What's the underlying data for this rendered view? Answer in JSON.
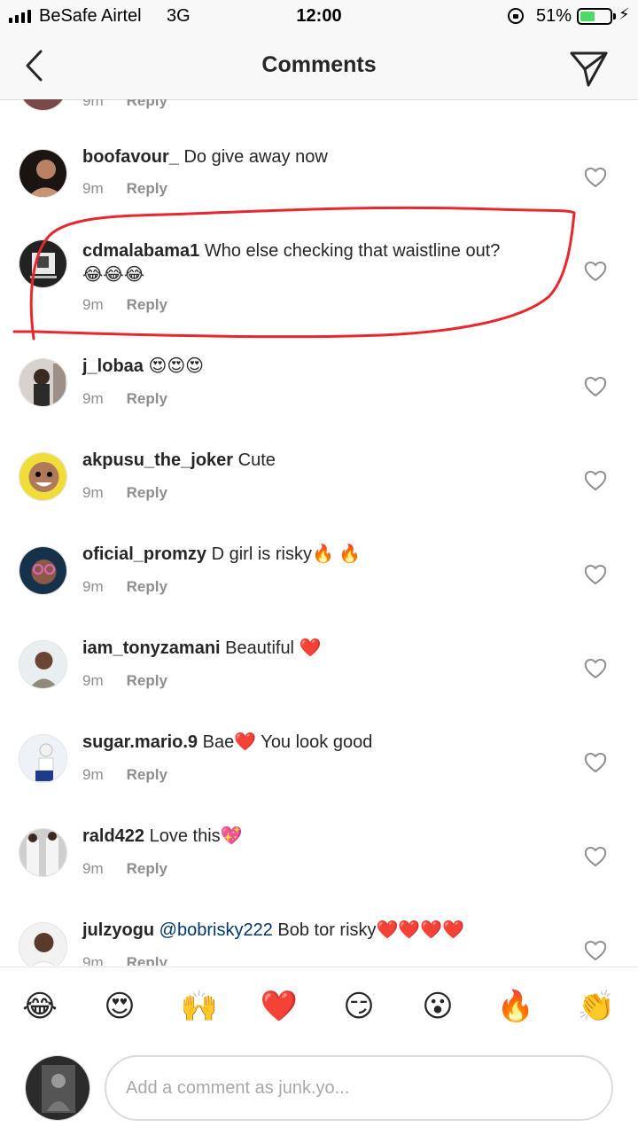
{
  "status_bar": {
    "carrier": "BeSafe Airtel",
    "network": "3G",
    "time": "12:00",
    "battery_percent": "51%",
    "battery_level": 0.51,
    "battery_color": "#4cd964"
  },
  "header": {
    "title": "Comments",
    "back_icon": "chevron-left-icon",
    "direct_icon": "paper-plane-icon"
  },
  "comments": [
    {
      "username": "boofavour_",
      "text": "Do give away now",
      "time": "9m",
      "reply": "Reply"
    },
    {
      "username": "cdmalabama1",
      "text": "Who else checking that waistline out?",
      "emoji": "😂😂😂",
      "time": "9m",
      "reply": "Reply"
    },
    {
      "username": "j_lobaa",
      "text": "😍😍😍",
      "time": "9m",
      "reply": "Reply"
    },
    {
      "username": "akpusu_the_joker",
      "text": "Cute",
      "time": "9m",
      "reply": "Reply"
    },
    {
      "username": "oficial_promzy",
      "text": "D girl is risky🔥 🔥",
      "time": "9m",
      "reply": "Reply"
    },
    {
      "username": "iam_tonyzamani",
      "text": "Beautiful ❤️",
      "time": "9m",
      "reply": "Reply"
    },
    {
      "username": "sugar.mario.9",
      "text": "Bae❤️ You look good",
      "time": "9m",
      "reply": "Reply"
    },
    {
      "username": "rald422",
      "text": "Love this💖",
      "time": "9m",
      "reply": "Reply"
    },
    {
      "username": "julzyogu",
      "mention": "@bobrisky222",
      "text": " Bob tor risky❤️❤️❤️❤️",
      "time": "9m",
      "reply": "Reply"
    }
  ],
  "highlight_color": "#e8262e",
  "emoji_bar": [
    "😂",
    "😍",
    "🙌",
    "❤️",
    "😏",
    "😮",
    "🔥",
    "👏"
  ],
  "composer": {
    "placeholder": "Add a comment as junk.yo..."
  }
}
